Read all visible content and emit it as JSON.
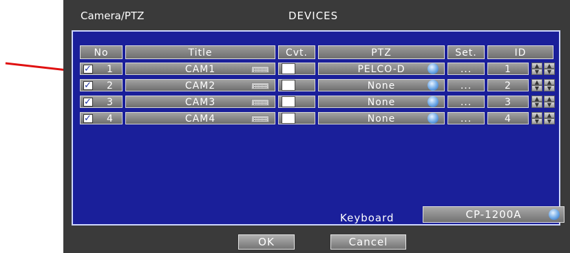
{
  "window": {
    "title": "Camera/PTZ",
    "section": "DEVICES"
  },
  "table": {
    "headers": {
      "no": "No",
      "title": "Title",
      "cvt": "Cvt.",
      "ptz": "PTZ",
      "set": "Set.",
      "id": "ID"
    },
    "rows": [
      {
        "checked": true,
        "no": "1",
        "title": "CAM1",
        "cvt": false,
        "ptz": "PELCO-D",
        "set": "...",
        "id": "1"
      },
      {
        "checked": true,
        "no": "2",
        "title": "CAM2",
        "cvt": false,
        "ptz": "None",
        "set": "...",
        "id": "2"
      },
      {
        "checked": true,
        "no": "3",
        "title": "CAM3",
        "cvt": false,
        "ptz": "None",
        "set": "...",
        "id": "3"
      },
      {
        "checked": true,
        "no": "4",
        "title": "CAM4",
        "cvt": false,
        "ptz": "None",
        "set": "...",
        "id": "4"
      }
    ]
  },
  "keyboard": {
    "label": "Keyboard",
    "value": "CP-1200A"
  },
  "buttons": {
    "ok": "OK",
    "cancel": "Cancel"
  },
  "colors": {
    "panel": "#1a1f9a",
    "frame": "#3a3a3a",
    "arrow": "#e01010"
  },
  "icons": {
    "checkbox": "checkmark-icon",
    "keyboard": "keyboard-icon",
    "dropdown": "globe-dropdown-icon",
    "spinner": "up-down-spinner-icon"
  }
}
